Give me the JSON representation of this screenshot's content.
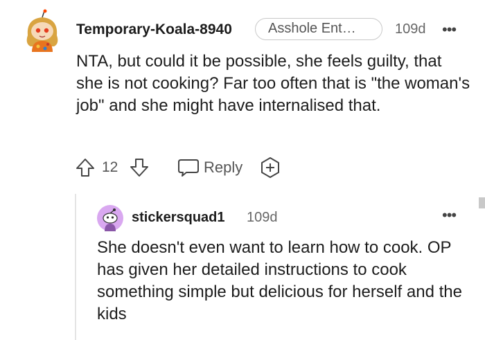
{
  "comment": {
    "username": "Temporary-Koala-8940",
    "flair": "Asshole Ent…",
    "time": "109d",
    "more": "•••",
    "body": "NTA, but could it be possible, she feels guilty, that she is not cooking? Far too often that is \"the woman's job\" and she might have internalised that.",
    "vote_count": "12",
    "reply_label": "Reply",
    "icons": {
      "upvote": "upvote-arrow-icon",
      "downvote": "downvote-arrow-icon",
      "reply": "speech-bubble-icon",
      "award": "award-plus-icon"
    }
  },
  "reply": {
    "username": "stickersquad1",
    "time": "109d",
    "more": "•••",
    "body": "She doesn't even want to learn how to cook. OP has given her detailed instructions to cook something simple but delicious for herself and the kids"
  },
  "colors": {
    "text": "#1c1c1c",
    "muted": "#555555",
    "avatar2_bg": "#d9a8f0",
    "thread_line": "#e4e4e4"
  }
}
